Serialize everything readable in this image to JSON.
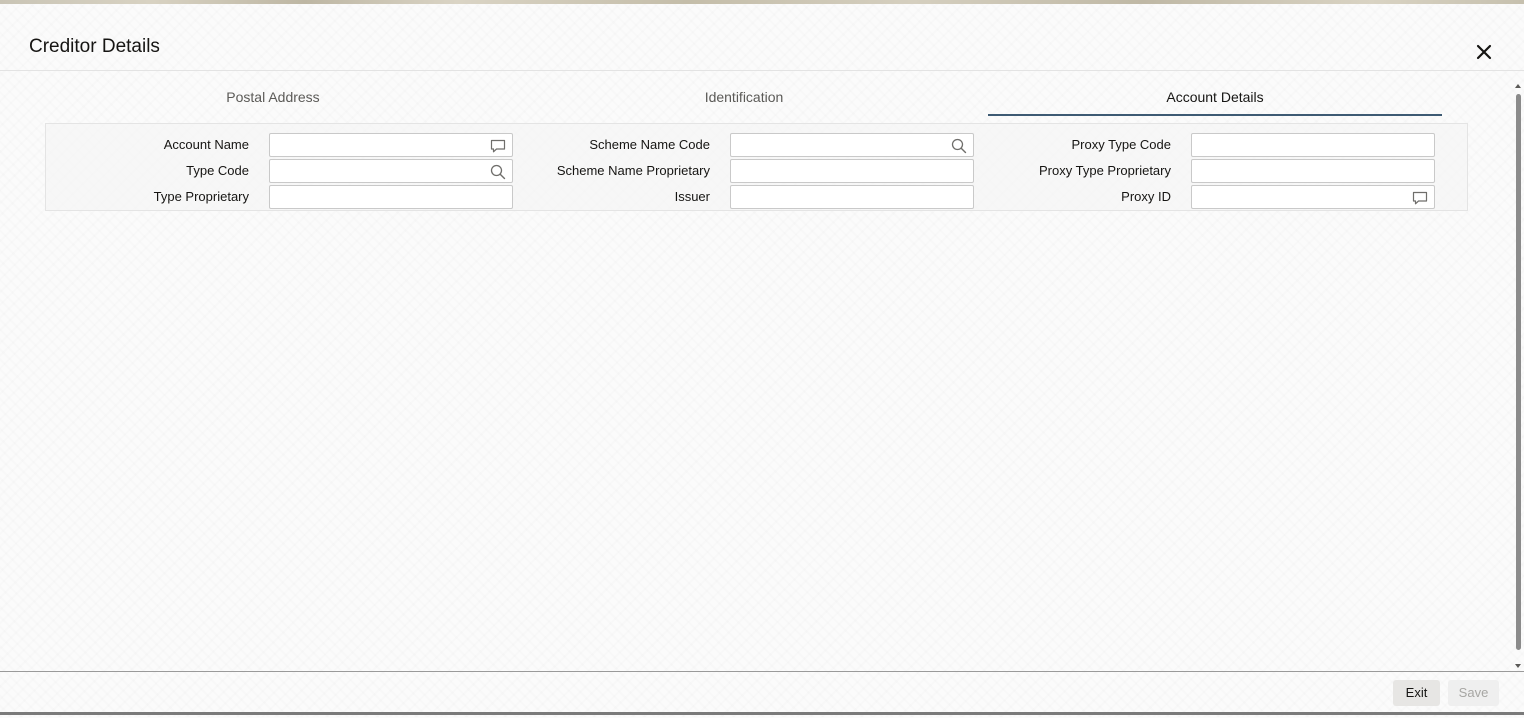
{
  "dialog": {
    "title": "Creditor Details"
  },
  "tabs": [
    {
      "label": "Postal Address",
      "active": false
    },
    {
      "label": "Identification",
      "active": false
    },
    {
      "label": "Account Details",
      "active": true
    }
  ],
  "fields": {
    "account_name": {
      "label": "Account Name",
      "value": "",
      "icon": "comment-icon"
    },
    "type_code": {
      "label": "Type Code",
      "value": "",
      "icon": "search-icon"
    },
    "type_proprietary": {
      "label": "Type Proprietary",
      "value": ""
    },
    "scheme_name_code": {
      "label": "Scheme Name Code",
      "value": "",
      "icon": "search-icon"
    },
    "scheme_name_proprietary": {
      "label": "Scheme Name Proprietary",
      "value": ""
    },
    "issuer": {
      "label": "Issuer",
      "value": ""
    },
    "proxy_type_code": {
      "label": "Proxy Type Code",
      "value": ""
    },
    "proxy_type_proprietary": {
      "label": "Proxy Type Proprietary",
      "value": ""
    },
    "proxy_id": {
      "label": "Proxy ID",
      "value": "",
      "icon": "comment-icon"
    }
  },
  "footer": {
    "exit_label": "Exit",
    "save_label": "Save"
  },
  "colors": {
    "active_tab_underline": "#3d5a73",
    "text": "#161513",
    "disabled_text": "#a7a6a3"
  }
}
